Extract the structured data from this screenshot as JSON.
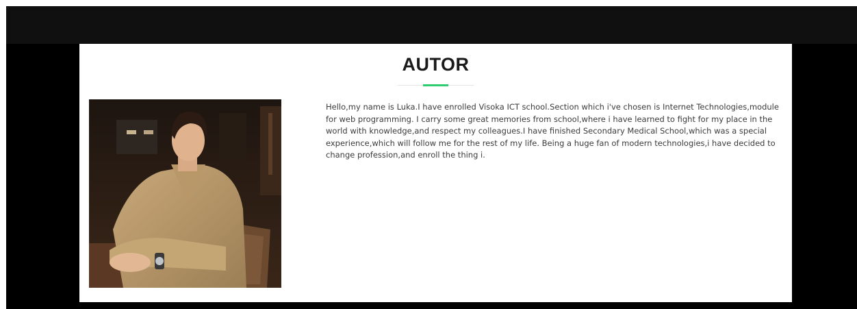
{
  "author_section": {
    "title": "AUTOR",
    "accent_color": "#2ecc71",
    "photo": {
      "subject": "young man in tan jacket seated at a table, wearing a wristwatch"
    },
    "bio": "Hello,my name is Luka.I have enrolled Visoka ICT school.Section which i've chosen is Internet Technologies,module for web programming. I carry some great memories from school,where i have learned to fight for my place in the world with knowledge,and respect my colleagues.I have finished Secondary Medical School,which was a special experience,which will follow me for the rest of my life. Being a huge fan of modern technologies,i have decided to change profession,and enroll the thing i."
  }
}
